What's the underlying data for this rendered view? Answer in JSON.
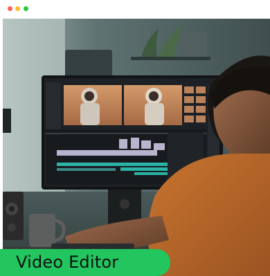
{
  "window": {
    "buttons": [
      {
        "name": "close",
        "color": "#ff5f57"
      },
      {
        "name": "minimize",
        "color": "#febc2e"
      },
      {
        "name": "maximize",
        "color": "#28c840"
      }
    ]
  },
  "card": {
    "title": "Video Editor",
    "accent_color": "#22c55e"
  }
}
